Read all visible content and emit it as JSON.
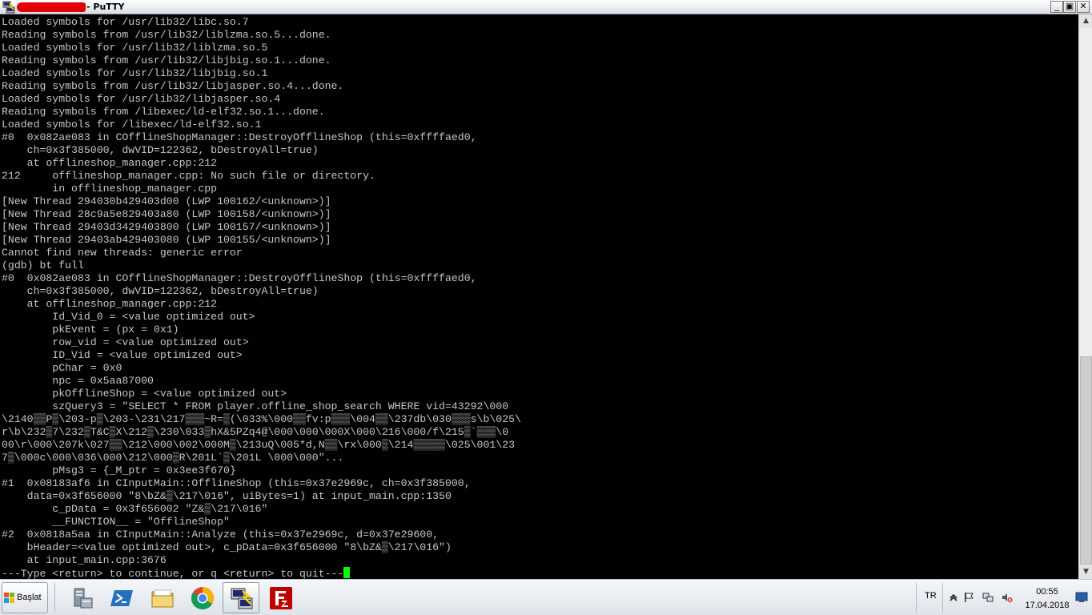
{
  "window": {
    "title": "- PuTTY",
    "minimize_label": "_",
    "maximize_label": "▣",
    "close_label": "✕"
  },
  "terminal": {
    "lines": [
      "Loaded symbols for /usr/lib32/libc.so.7",
      "Reading symbols from /usr/lib32/liblzma.so.5...done.",
      "Loaded symbols for /usr/lib32/liblzma.so.5",
      "Reading symbols from /usr/lib32/libjbig.so.1...done.",
      "Loaded symbols for /usr/lib32/libjbig.so.1",
      "Reading symbols from /usr/lib32/libjasper.so.4...done.",
      "Loaded symbols for /usr/lib32/libjasper.so.4",
      "Reading symbols from /libexec/ld-elf32.so.1...done.",
      "Loaded symbols for /libexec/ld-elf32.so.1",
      "#0  0x082ae083 in COfflineShopManager::DestroyOfflineShop (this=0xffffaed0,",
      "    ch=0x3f385000, dwVID=122362, bDestroyAll=true)",
      "    at offlineshop_manager.cpp:212",
      "212     offlineshop_manager.cpp: No such file or directory.",
      "        in offlineshop_manager.cpp",
      "[New Thread 294030b429403d00 (LWP 100162/<unknown>)]",
      "[New Thread 28c9a5e829403a80 (LWP 100158/<unknown>)]",
      "[New Thread 29403d3429403800 (LWP 100157/<unknown>)]",
      "[New Thread 29403ab429403080 (LWP 100155/<unknown>)]",
      "Cannot find new threads: generic error",
      "(gdb) bt full",
      "#0  0x082ae083 in COfflineShopManager::DestroyOfflineShop (this=0xffffaed0,",
      "    ch=0x3f385000, dwVID=122362, bDestroyAll=true)",
      "    at offlineshop_manager.cpp:212",
      "        Id_Vid_0 = <value optimized out>",
      "        pkEvent = (px = 0x1)",
      "        row_vid = <value optimized out>",
      "        ID_Vid = <value optimized out>",
      "        pChar = 0x0",
      "        npc = 0x5aa87000",
      "        pkOfflineShop = <value optimized out>",
      "        szQuery3 = \"SELECT * FROM player.offline_shop_search WHERE vid=43292\\000",
      "\\2140▒▒P▒\\203-p▒\\203-\\231\\217▒▒▒~R=▒(\\033%\\000▒▒fv:p▒▒▒\\004▒▒\\237db\\030▒▒▒s\\b\\025\\",
      "r\\b\\232▒7\\232▒T&C▒X\\212▒\\230\\033▒hX&5PZq4@\\000\\000\\000X\\000\\216\\000/f\\215▒`▒▒▒\\0",
      "00\\r\\000\\207k\\027▒▒\\212\\000\\002\\000M▒\\213uQ\\005*d,N▒▒\\rx\\000▒\\214▒▒▒▒▒\\025\\001\\23",
      "7▒\\000c\\000\\036\\000\\212\\000▒R\\201L`▒\\201L \\000\\000\"...",
      "        pMsg3 = {_M_ptr = 0x3ee3f670}",
      "#1  0x08183af6 in CInputMain::OfflineShop (this=0x37e2969c, ch=0x3f385000,",
      "    data=0x3f656000 \"8\\bZ&▒\\217\\016\", uiBytes=1) at input_main.cpp:1350",
      "        c_pData = 0x3f656002 \"Z&▒\\217\\016\"",
      "        __FUNCTION__ = \"OfflineShop\"",
      "#2  0x0818a5aa in CInputMain::Analyze (this=0x37e2969c, d=0x37e29600,",
      "    bHeader=<value optimized out>, c_pData=0x3f656000 \"8\\bZ&▒\\217\\016\")",
      "    at input_main.cpp:3676",
      "---Type <return> to continue, or q <return> to quit---"
    ]
  },
  "scrollbar": {
    "up_label": "▲",
    "down_label": "▼"
  },
  "taskbar": {
    "start_label": "Başlat",
    "apps": [
      {
        "name": "server-manager-icon"
      },
      {
        "name": "powershell-icon"
      },
      {
        "name": "file-explorer-icon"
      },
      {
        "name": "chrome-icon"
      },
      {
        "name": "putty-icon"
      },
      {
        "name": "filezilla-icon"
      }
    ],
    "language": "TR",
    "time": "00:55",
    "date": "17.04.2018"
  }
}
